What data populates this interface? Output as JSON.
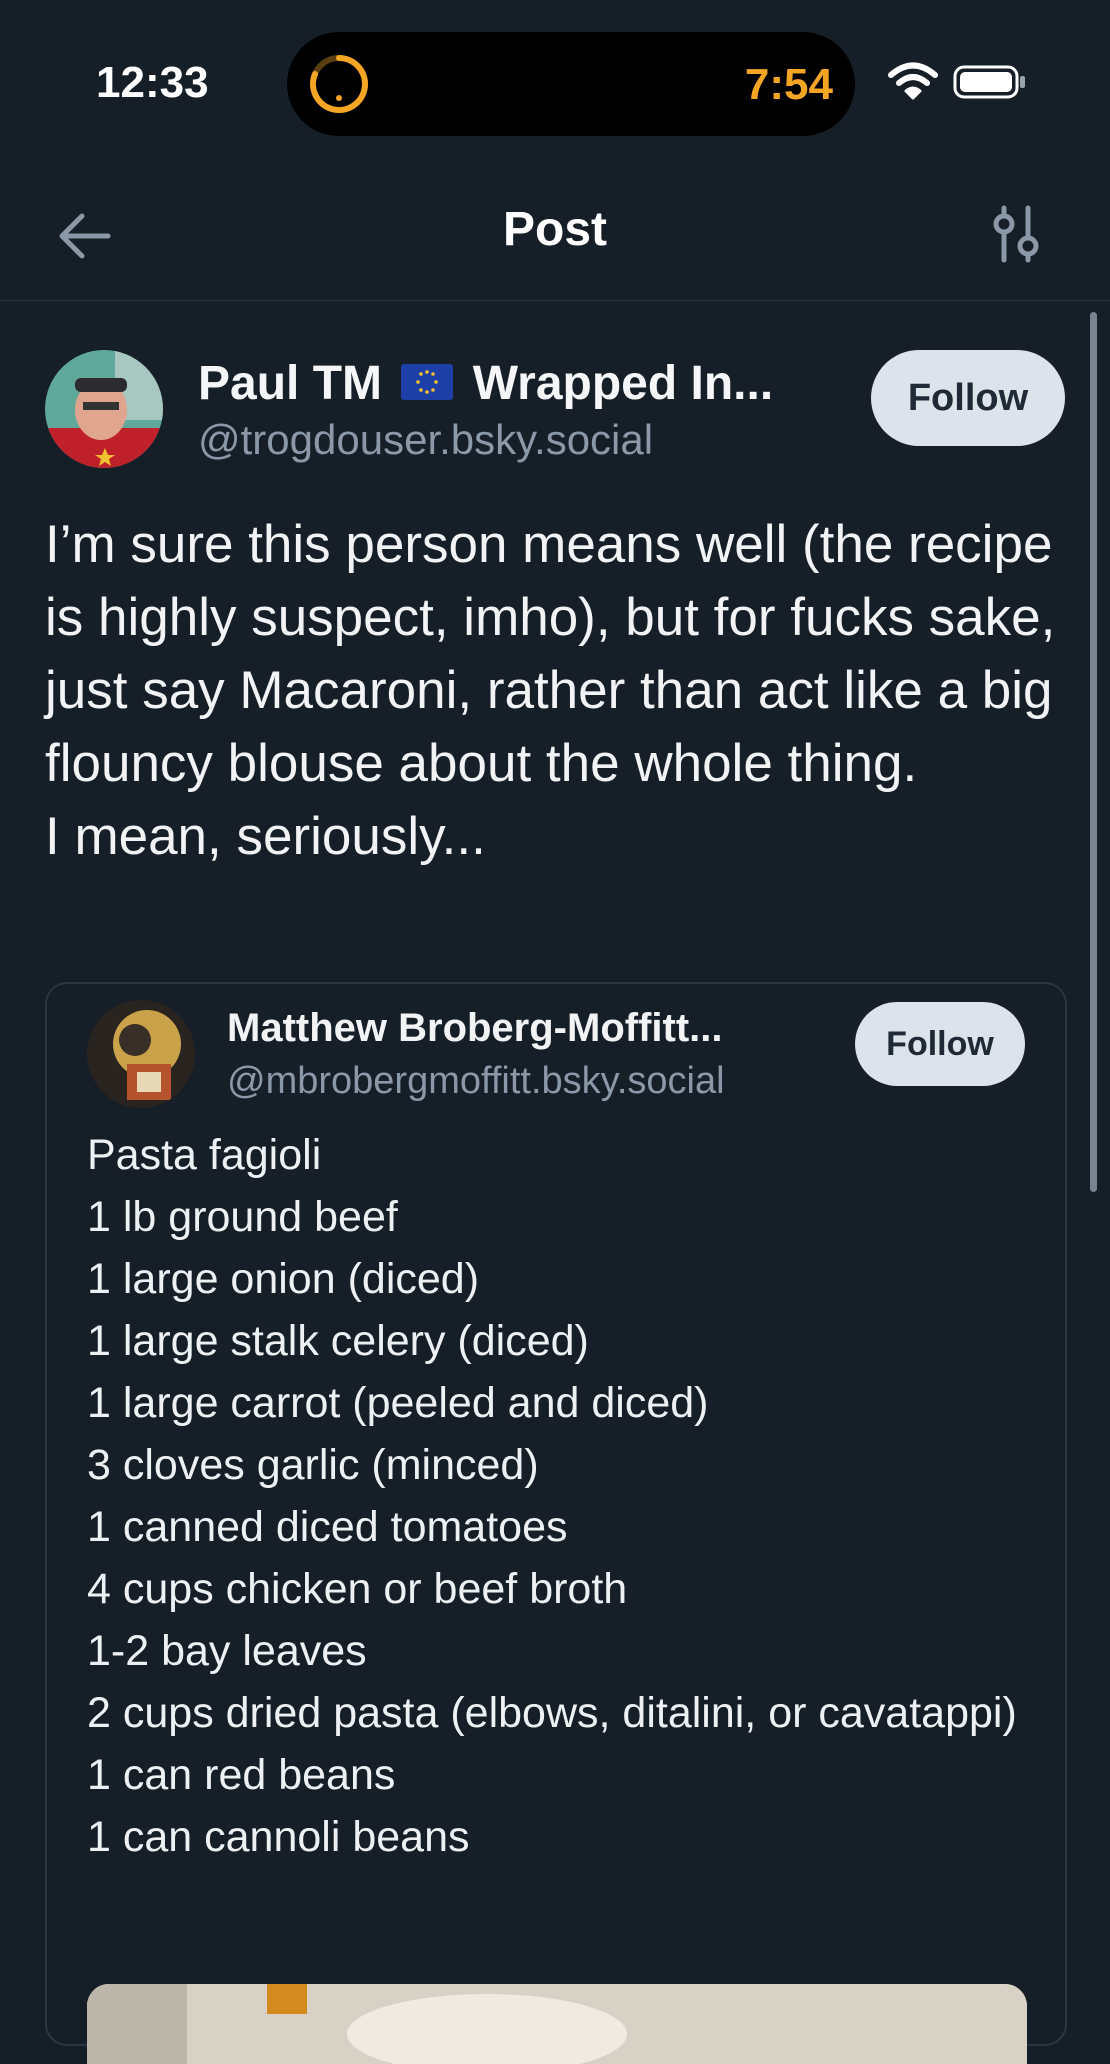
{
  "status_bar": {
    "time": "12:33",
    "timer_time": "7:54",
    "timer_color": "#f5a524"
  },
  "nav": {
    "title": "Post",
    "back_icon": "arrow-left-icon",
    "filter_icon": "sliders-icon"
  },
  "post": {
    "author_name": "Paul TM",
    "author_name_suffix": "Wrapped In...",
    "flag_icon": "eu-flag-icon",
    "handle": "@trogdouser.bsky.social",
    "follow_label": "Follow",
    "text": "I’m sure this person means well (the recipe is highly suspect, imho), but for fucks sake, just say Macaroni, rather than act like a big flouncy blouse about the whole thing.\nI mean, seriously..."
  },
  "quote": {
    "author_name": "Matthew Broberg-Moffitt...",
    "handle": "@mbrobergmoffitt.bsky.social",
    "follow_label": "Follow",
    "lines": [
      "Pasta fagioli",
      "1 lb ground beef",
      "1 large onion (diced)",
      "1 large stalk celery (diced)",
      "1 large carrot (peeled and diced)",
      "3 cloves garlic (minced)",
      "1 canned diced tomatoes",
      "4 cups chicken or beef broth",
      "1-2 bay leaves",
      "2 cups dried pasta (elbows, ditalini, or cavatappi)",
      "1 can red beans",
      "1 can cannoli beans"
    ]
  },
  "colors": {
    "background": "#161e27",
    "follow_button": "#dde3ea",
    "handle_text": "#8b98a8"
  }
}
